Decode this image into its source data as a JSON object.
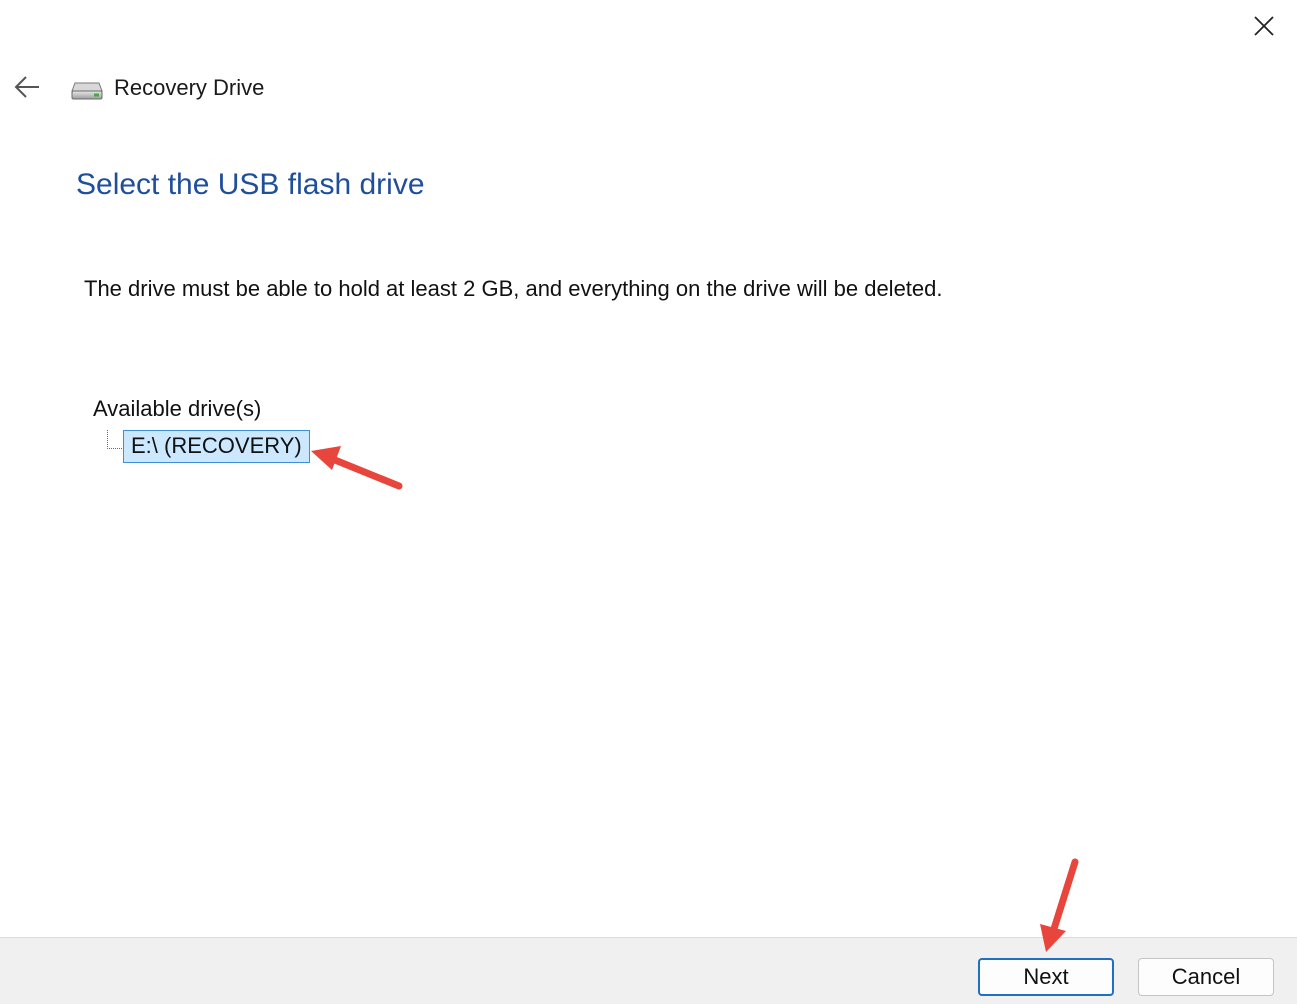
{
  "window": {
    "title": "Recovery Drive",
    "icon": "usb-drive-icon",
    "close_icon": "close-icon",
    "back_icon": "back-arrow-icon"
  },
  "page": {
    "heading": "Select the USB flash drive",
    "instruction": "The drive must be able to hold at least 2 GB, and everything on the drive will be deleted."
  },
  "drives": {
    "root_label": "Available drive(s)",
    "items": [
      {
        "label": "E:\\ (RECOVERY)",
        "selected": true
      }
    ]
  },
  "footer": {
    "next_label": "Next",
    "cancel_label": "Cancel"
  },
  "colors": {
    "heading": "#1f4e9b",
    "selection_bg": "#cce8ff",
    "selection_border": "#3c8fd8",
    "primary_button_border": "#1f6fc4",
    "annotation_arrow": "#e8453c"
  }
}
